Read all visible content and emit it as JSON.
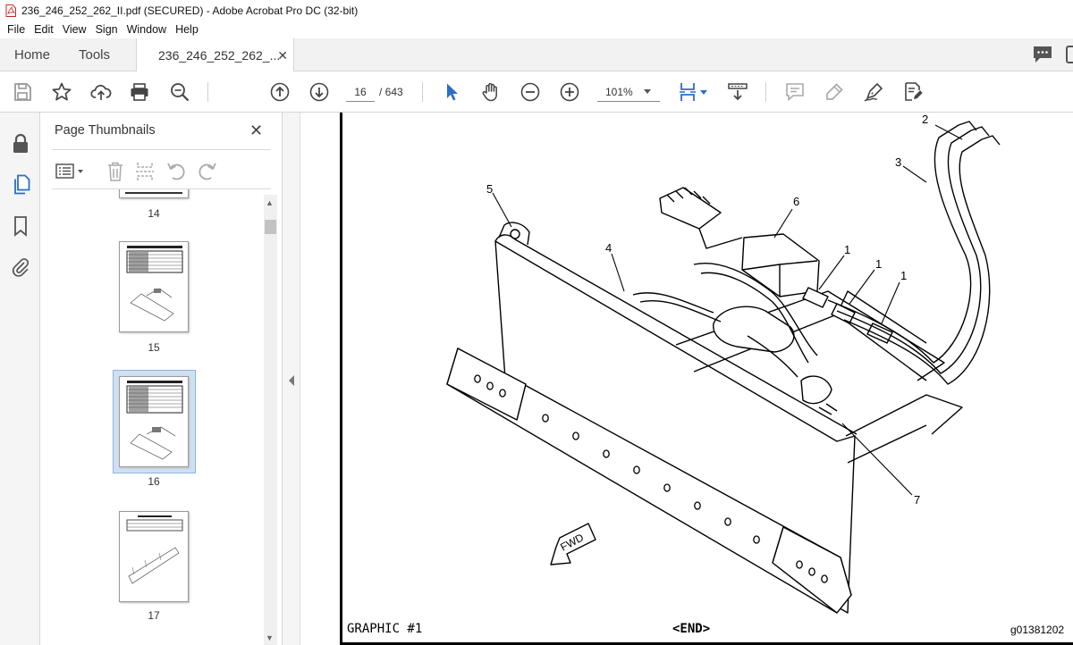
{
  "window": {
    "title": "236_246_252_262_II.pdf (SECURED) - Adobe Acrobat Pro DC (32-bit)"
  },
  "menu": [
    "File",
    "Edit",
    "View",
    "Sign",
    "Window",
    "Help"
  ],
  "tabs": {
    "home": "Home",
    "tools": "Tools",
    "document": "236_246_252_262_..."
  },
  "toolbar": {
    "current_page": "16",
    "page_total": "/ 643",
    "zoom": "101%"
  },
  "panel": {
    "title": "Page Thumbnails",
    "thumbnails": [
      {
        "label": "14"
      },
      {
        "label": "15"
      },
      {
        "label": "16",
        "selected": true
      },
      {
        "label": "17"
      }
    ]
  },
  "document": {
    "callouts": [
      "1",
      "1",
      "1",
      "2",
      "3",
      "4",
      "5",
      "6",
      "7"
    ],
    "graphic_label": "GRAPHIC #1",
    "end_label": "<END>",
    "graphic_code": "g01381202",
    "fwd_label": "FWD"
  },
  "colors": {
    "accent_blue": "#2b6fc4",
    "panel_bg": "#f5f5f5",
    "selection": "#cfe0f2"
  }
}
